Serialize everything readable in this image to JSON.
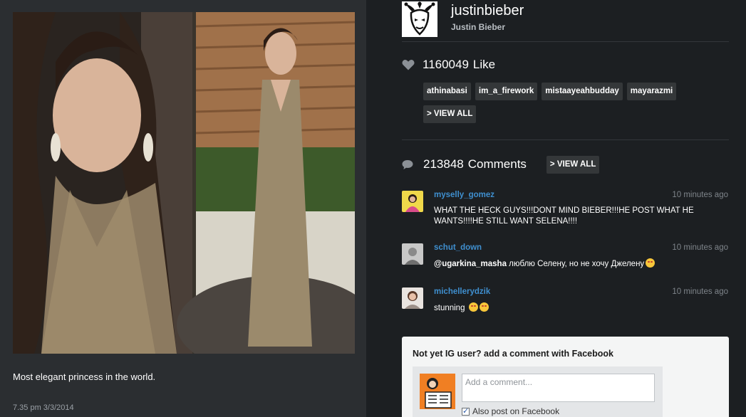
{
  "post": {
    "caption": "Most elegant princess in the world.",
    "timestamp": "7.35 pm 3/3/2014"
  },
  "profile": {
    "username": "justinbieber",
    "full_name": "Justin Bieber"
  },
  "likes": {
    "icon": "heart-icon",
    "count": "1160049",
    "label": "Like",
    "likers": [
      "athinabasi",
      "im_a_firework",
      "mistaayeahbudday",
      "mayarazmi"
    ],
    "view_all": "> VIEW ALL"
  },
  "comments": {
    "icon": "speech-bubble-icon",
    "count": "213848",
    "label": "Comments",
    "view_all": "> VIEW ALL",
    "items": [
      {
        "user": "myselly_gomez",
        "time": "10 minutes ago",
        "text": "WHAT THE HECK GUYS!!!DONT MIND BIEBER!!!HE POST WHAT HE WANTS!!!!HE STILL WANT SELENA!!!!"
      },
      {
        "user": "schut_down",
        "time": "10 minutes ago",
        "mention": "@ugarkina_masha",
        "text": " люблю Селену, но не хочу Джелену"
      },
      {
        "user": "michellerydzik",
        "time": "10 minutes ago",
        "text": "stunning"
      }
    ]
  },
  "facebook": {
    "title": "Not yet IG user? add a comment with Facebook",
    "placeholder": "Add a comment...",
    "also_post_label": "Also post on Facebook",
    "also_post_checked": true
  },
  "colors": {
    "background": "#1c1f22",
    "panel": "#2b2e31",
    "link": "#3f8fcf",
    "tag_bg": "#343739"
  }
}
